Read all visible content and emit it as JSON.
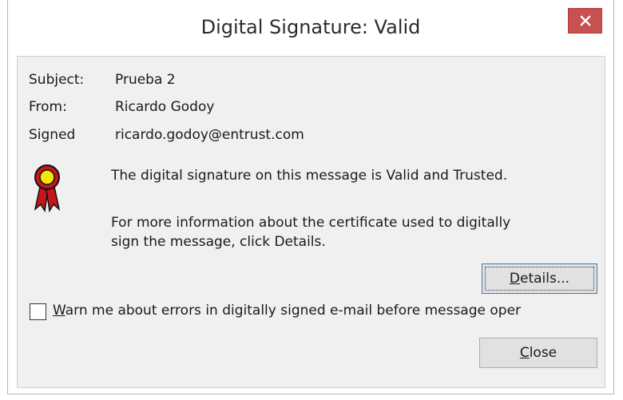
{
  "window": {
    "title": "Digital Signature: Valid",
    "close_glyph": "✕"
  },
  "fields": [
    {
      "label": "Subject:",
      "value": "Prueba 2"
    },
    {
      "label": "From:",
      "value": "Ricardo Godoy"
    },
    {
      "label": "Signed",
      "value": "ricardo.godoy@entrust.com"
    }
  ],
  "status_icon": "ribbon-award-icon",
  "messages": {
    "valid": "The digital signature on this message is Valid and Trusted.",
    "info_line1": "For more information about the certificate used to digitally",
    "info_line2": "sign the message, click Details."
  },
  "buttons": {
    "details": {
      "mnemonic": "D",
      "rest": "etails..."
    },
    "close": {
      "mnemonic": "C",
      "rest": "lose"
    }
  },
  "checkbox": {
    "mnemonic": "W",
    "rest": "arn me about errors in digitally signed e-mail before message oper",
    "checked": false
  },
  "colors": {
    "close_button": "#c75050",
    "dialog_bg": "#f0f0f0",
    "ribbon_red": "#c4161c",
    "ribbon_yellow": "#f5e50a"
  }
}
